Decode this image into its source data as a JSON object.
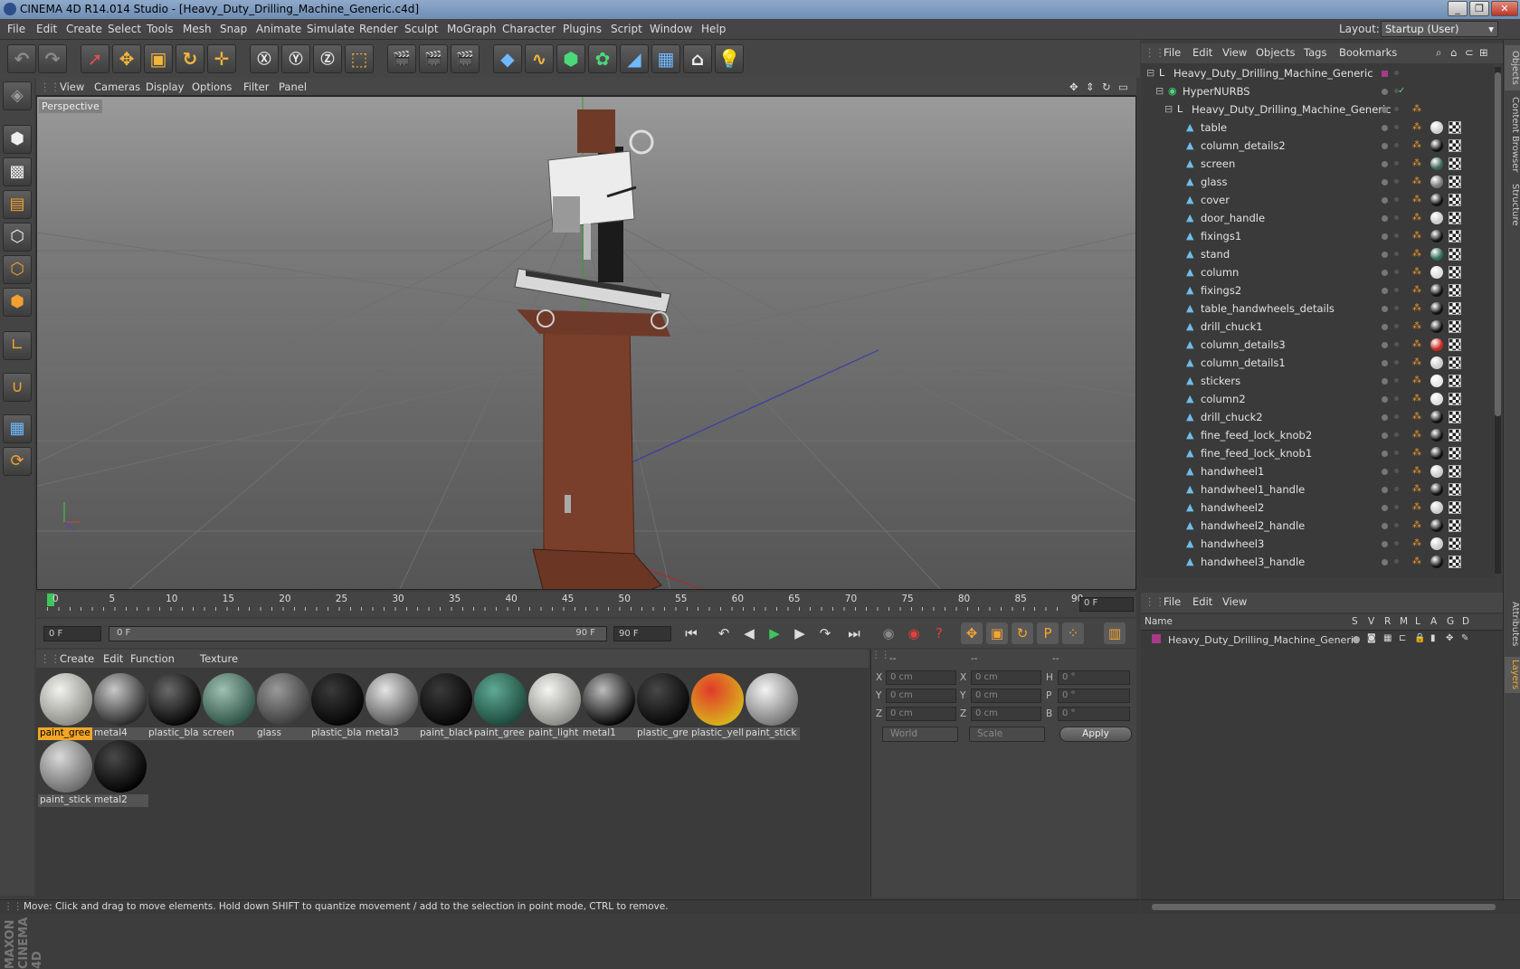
{
  "window": {
    "title": "CINEMA 4D R14.014 Studio - [Heavy_Duty_Drilling_Machine_Generic.c4d]",
    "min": "_",
    "restore": "❐",
    "close": "✕"
  },
  "menu": [
    "File",
    "Edit",
    "Create",
    "Select",
    "Tools",
    "Mesh",
    "Snap",
    "Animate",
    "Simulate",
    "Render",
    "Sculpt",
    "MoGraph",
    "Character",
    "Plugins",
    "Script",
    "Window",
    "Help"
  ],
  "layout": {
    "label": "Layout:",
    "value": "Startup (User)"
  },
  "viewport": {
    "menu": [
      "View",
      "Cameras",
      "Display",
      "Options",
      "Filter",
      "Panel"
    ],
    "label": "Perspective"
  },
  "timeline": {
    "ticks": [
      "0",
      "5",
      "10",
      "15",
      "20",
      "25",
      "30",
      "35",
      "40",
      "45",
      "50",
      "55",
      "60",
      "65",
      "70",
      "75",
      "80",
      "85",
      "90"
    ],
    "current": "0 F"
  },
  "transport": {
    "start": "0 F",
    "range_start": "0 F",
    "range_end": "90 F",
    "end": "90 F"
  },
  "materials": {
    "menu": [
      "Create",
      "Edit",
      "Function",
      "Texture"
    ],
    "items": [
      {
        "label": "paint_gree",
        "c1": "#f2f2ee",
        "c2": "#8d8d88",
        "selected": true
      },
      {
        "label": "metal4",
        "c1": "#c9c9c9",
        "c2": "#2a2a2a"
      },
      {
        "label": "plastic_bla",
        "c1": "#6a6a6a",
        "c2": "#050505"
      },
      {
        "label": "screen",
        "c1": "#9fc0b2",
        "c2": "#2f5548"
      },
      {
        "label": "glass",
        "c1": "#9a9a9a",
        "c2": "#3c3c3c"
      },
      {
        "label": "plastic_bla",
        "c1": "#3a3a3a",
        "c2": "#050505"
      },
      {
        "label": "metal3",
        "c1": "#e5e5e5",
        "c2": "#555555"
      },
      {
        "label": "paint_black",
        "c1": "#3a3a3a",
        "c2": "#060606"
      },
      {
        "label": "paint_gree",
        "c1": "#5fa993",
        "c2": "#1d4a3d"
      },
      {
        "label": "paint_light",
        "c1": "#f5f5f2",
        "c2": "#8a8a86"
      },
      {
        "label": "metal1",
        "c1": "#bdbdbd",
        "c2": "#050505"
      },
      {
        "label": "plastic_gre",
        "c1": "#484848",
        "c2": "#070707"
      },
      {
        "label": "plastic_yell",
        "c1": "#e23a2a",
        "c2": "#d8b21c"
      },
      {
        "label": "paint_stick",
        "c1": "#f4f4f4",
        "c2": "#777777"
      },
      {
        "label": "paint_stick",
        "c1": "#d9d9d9",
        "c2": "#6b6b6b"
      },
      {
        "label": "metal2",
        "c1": "#4a4a4a",
        "c2": "#020202"
      }
    ]
  },
  "coords": {
    "head": [
      "--",
      "--",
      "--"
    ],
    "rows": [
      {
        "a": "X",
        "av": "0 cm",
        "b": "X",
        "bv": "0 cm",
        "c": "H",
        "cv": "0 °"
      },
      {
        "a": "Y",
        "av": "0 cm",
        "b": "Y",
        "bv": "0 cm",
        "c": "P",
        "cv": "0 °"
      },
      {
        "a": "Z",
        "av": "0 cm",
        "b": "Z",
        "bv": "0 cm",
        "c": "B",
        "cv": "0 °"
      }
    ],
    "mode": "World",
    "scale": "Scale",
    "apply": "Apply"
  },
  "objects": {
    "menu": [
      "File",
      "Edit",
      "View",
      "Objects",
      "Tags",
      "Bookmarks"
    ],
    "items": [
      {
        "name": "Heavy_Duty_Drilling_Machine_Generic",
        "depth": 0,
        "icon": "null",
        "m1": ""
      },
      {
        "name": "HyperNURBS",
        "depth": 1,
        "icon": "nurbs",
        "m1": ""
      },
      {
        "name": "Heavy_Duty_Drilling_Machine_Generic",
        "depth": 2,
        "icon": "null",
        "m1": ""
      },
      {
        "name": "table",
        "depth": 3,
        "icon": "poly",
        "m1": "#cfcfcf"
      },
      {
        "name": "column_details2",
        "depth": 3,
        "icon": "poly",
        "m1": "#111111"
      },
      {
        "name": "screen",
        "depth": 3,
        "icon": "poly",
        "m1": "#3a6657"
      },
      {
        "name": "glass",
        "depth": 3,
        "icon": "poly",
        "m1": "#777777"
      },
      {
        "name": "cover",
        "depth": 3,
        "icon": "poly",
        "m1": "#111111"
      },
      {
        "name": "door_handle",
        "depth": 3,
        "icon": "poly",
        "m1": "#cccccc"
      },
      {
        "name": "fixings1",
        "depth": 3,
        "icon": "poly",
        "m1": "#111111"
      },
      {
        "name": "stand",
        "depth": 3,
        "icon": "poly",
        "m1": "#2f6b5a"
      },
      {
        "name": "column",
        "depth": 3,
        "icon": "poly",
        "m1": "#dddddd"
      },
      {
        "name": "fixings2",
        "depth": 3,
        "icon": "poly",
        "m1": "#111111"
      },
      {
        "name": "table_handwheels_details",
        "depth": 3,
        "icon": "poly",
        "m1": "#111111"
      },
      {
        "name": "drill_chuck1",
        "depth": 3,
        "icon": "poly",
        "m1": "#111111"
      },
      {
        "name": "column_details3",
        "depth": 3,
        "icon": "poly",
        "m1": "#c8281e"
      },
      {
        "name": "column_details1",
        "depth": 3,
        "icon": "poly",
        "m1": "#cccccc"
      },
      {
        "name": "stickers",
        "depth": 3,
        "icon": "poly",
        "m1": "#e6e6e6"
      },
      {
        "name": "column2",
        "depth": 3,
        "icon": "poly",
        "m1": "#dddddd"
      },
      {
        "name": "drill_chuck2",
        "depth": 3,
        "icon": "poly",
        "m1": "#111111"
      },
      {
        "name": "fine_feed_lock_knob2",
        "depth": 3,
        "icon": "poly",
        "m1": "#111111"
      },
      {
        "name": "fine_feed_lock_knob1",
        "depth": 3,
        "icon": "poly",
        "m1": "#111111"
      },
      {
        "name": "handwheel1",
        "depth": 3,
        "icon": "poly",
        "m1": "#cccccc"
      },
      {
        "name": "handwheel1_handle",
        "depth": 3,
        "icon": "poly",
        "m1": "#111111"
      },
      {
        "name": "handwheel2",
        "depth": 3,
        "icon": "poly",
        "m1": "#cccccc"
      },
      {
        "name": "handwheel2_handle",
        "depth": 3,
        "icon": "poly",
        "m1": "#111111"
      },
      {
        "name": "handwheel3",
        "depth": 3,
        "icon": "poly",
        "m1": "#cccccc"
      },
      {
        "name": "handwheel3_handle",
        "depth": 3,
        "icon": "poly",
        "m1": "#111111"
      }
    ]
  },
  "layers": {
    "menu": [
      "File",
      "Edit",
      "View"
    ],
    "head": {
      "name": "Name",
      "cols": [
        "S",
        "V",
        "R",
        "M",
        "L",
        "A",
        "G",
        "D"
      ]
    },
    "row": "Heavy_Duty_Drilling_Machine_Generic"
  },
  "side_tabs": [
    "Objects",
    "Content Browser",
    "Structure",
    "Attributes",
    "Layers"
  ],
  "status": "Move: Click and drag to move elements. Hold down SHIFT to quantize movement / add to the selection in point mode, CTRL to remove.",
  "brand": "MAXON CINEMA 4D"
}
